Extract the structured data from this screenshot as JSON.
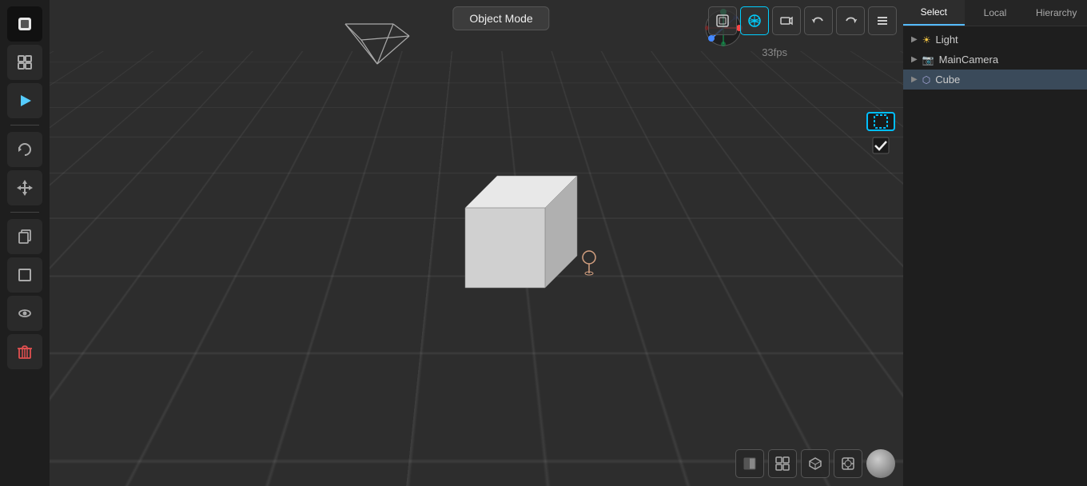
{
  "header": {
    "object_mode_label": "Object Mode",
    "fps": "33fps"
  },
  "toolbar": {
    "tools": [
      {
        "name": "blender-logo",
        "icon": "⬡",
        "active": true
      },
      {
        "name": "scene-icon",
        "icon": "◻",
        "active": false
      },
      {
        "name": "play-icon",
        "icon": "▶",
        "active": false
      },
      {
        "name": "refresh-icon",
        "icon": "↻",
        "active": false
      },
      {
        "name": "move-icon",
        "icon": "✛",
        "active": false
      }
    ]
  },
  "viewport_icons": [
    {
      "name": "axis-icon",
      "icon": "⊕"
    },
    {
      "name": "perspective-icon",
      "icon": "⬡"
    },
    {
      "name": "shading-icon",
      "icon": "👁"
    },
    {
      "name": "camera-icon",
      "icon": "📷"
    },
    {
      "name": "undo-icon",
      "icon": "↩"
    },
    {
      "name": "redo-icon",
      "icon": "↪"
    },
    {
      "name": "menu-icon",
      "icon": "≡"
    }
  ],
  "left_sidebar": [
    {
      "name": "copy-icon",
      "icon": "⧉"
    },
    {
      "name": "frame-icon",
      "icon": "▢"
    },
    {
      "name": "eye-icon",
      "icon": "◉"
    },
    {
      "name": "trash-icon",
      "icon": "🗑",
      "red": true
    }
  ],
  "right_panel": {
    "tabs": [
      {
        "label": "Select",
        "active": true
      },
      {
        "label": "Local",
        "active": false
      },
      {
        "label": "Hierarchy",
        "active": false
      }
    ],
    "hierarchy_items": [
      {
        "label": "Light",
        "icon": "▶",
        "selected": false
      },
      {
        "label": "MainCamera",
        "icon": "▶",
        "selected": false
      },
      {
        "label": "Cube",
        "icon": "▶",
        "selected": true
      }
    ]
  },
  "bottom_toolbar": [
    {
      "name": "shading-flat-icon",
      "icon": "◧"
    },
    {
      "name": "shading-solid-icon",
      "icon": "⊞"
    },
    {
      "name": "shading-material-icon",
      "icon": "⬡"
    },
    {
      "name": "shading-rendered-icon",
      "icon": "⧈"
    },
    {
      "name": "sphere-icon",
      "icon": "●"
    }
  ]
}
